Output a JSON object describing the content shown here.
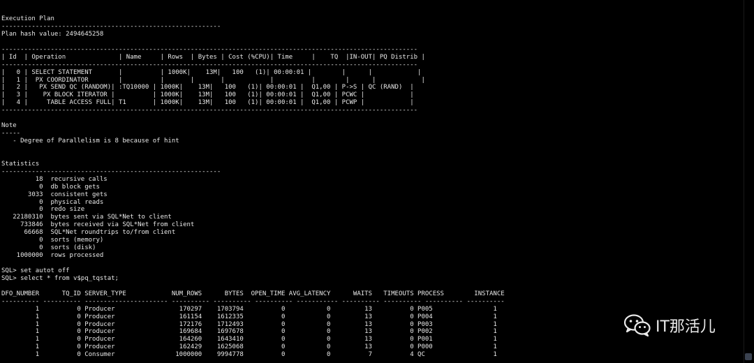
{
  "terminal": {
    "lines": [
      "Execution Plan",
      "----------------------------------------------------------",
      "Plan hash value: 2494645258",
      "",
      "--------------------------------------------------------------------------------------------------------------",
      "| Id  | Operation              | Name     | Rows  | Bytes | Cost (%CPU)| Time     |    TQ  |IN-OUT| PQ Distrib |",
      "--------------------------------------------------------------------------------------------------------------",
      "|   0 | SELECT STATEMENT       |          | 1000K|    13M|   100   (1)| 00:00:01 |        |      |            |",
      "|   1 |  PX COORDINATOR        |          |       |       |            |          |        |      |            |",
      "|   2 |   PX SEND QC (RANDOM)| :TQ10000 | 1000K|    13M|   100   (1)| 00:00:01 |  Q1,00 | P->S | QC (RAND)  |",
      "|   3 |    PX BLOCK ITERATOR |          | 1000K|    13M|   100   (1)| 00:00:01 |  Q1,00 | PCWC |            |",
      "|   4 |     TABLE ACCESS FULL| T1       | 1000K|    13M|   100   (1)| 00:00:01 |  Q1,00 | PCWP |            |",
      "--------------------------------------------------------------------------------------------------------------",
      "",
      "Note",
      "-----",
      "   - Degree of Parallelism is 8 because of hint",
      "",
      "",
      "Statistics",
      "----------------------------------------------------------",
      "         18  recursive calls",
      "          0  db block gets",
      "       3033  consistent gets",
      "          0  physical reads",
      "          0  redo size",
      "   22180310  bytes sent via SQL*Net to client",
      "     733846  bytes received via SQL*Net from client",
      "      66668  SQL*Net roundtrips to/from client",
      "          0  sorts (memory)",
      "          0  sorts (disk)",
      "    1000000  rows processed",
      "",
      "SQL> set autot off",
      "SQL> select * from v$pq_tqstat;",
      "",
      "DFO_NUMBER      TQ_ID SERVER_TYPE            NUM_ROWS      BYTES  OPEN_TIME AVG_LATENCY      WAITS   TIMEOUTS PROCESS        INSTANCE",
      "---------- ---------- ---------------------- ---------- ---------- ---------- ----------- ---------- ---------- ---------- ----------",
      "         1          0 Producer                 170297    1703794          0           0         13          0 P005                1",
      "         1          0 Producer                 161154    1612335          0           0         13          0 P004                1",
      "         1          0 Producer                 172176    1712493          0           0         13          0 P003                1",
      "         1          0 Producer                 169684    1697678          0           0         13          0 P002                1",
      "         1          0 Producer                 164260    1643410          0           0         13          0 P001                1",
      "         1          0 Producer                 162429    1625068          0           0         13          0 P000                1",
      "         1          0 Consumer                1000000    9994778          0           0          7          4 QC                  1"
    ]
  },
  "watermark": {
    "text": "IT那活儿",
    "icon": "wechat-icon"
  },
  "colors": {
    "background": "#000000",
    "foreground": "#e8e8e8"
  }
}
